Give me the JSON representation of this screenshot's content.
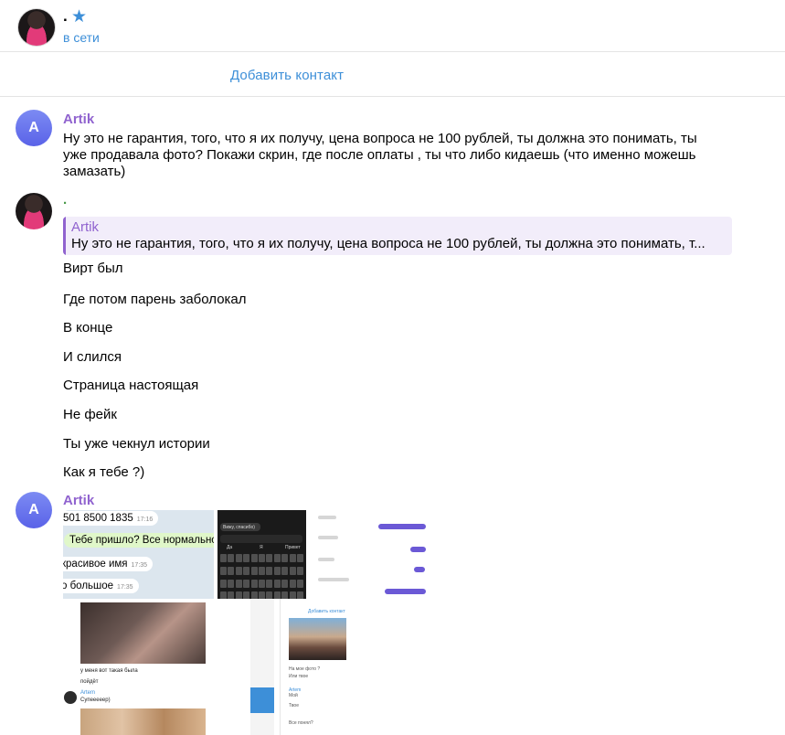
{
  "header": {
    "contact_name": ".",
    "status": "в сети",
    "star_icon": "star-icon"
  },
  "add_contact": {
    "label": "Добавить контакт"
  },
  "messages": [
    {
      "sender": "Artik",
      "avatar_letter": "A",
      "text_lines": [
        "Ну это не гарантия, того, что я их получу, цена вопроса не 100 рублей, ты должна это понимать, ты",
        "уже продавала фото? Покажи скрин, где после оплаты , ты что либо кидаешь (что именно можешь",
        "замазать)"
      ]
    },
    {
      "sender": ".",
      "reply": {
        "name": "Artik",
        "text": "Ну это не гарантия, того, что я их получу, цена вопроса не 100 рублей, ты должна это понимать, т..."
      },
      "lines": [
        "Вирт был",
        "Где потом парень заболокал",
        "В конце",
        "И слился",
        "Страница настоящая",
        "Не фейк",
        "Ты уже чекнул истории",
        "Как я тебе ?)"
      ]
    },
    {
      "sender": "Artik",
      "avatar_letter": "A",
      "screenshot1": {
        "row1": "501 8500 1835",
        "row1_time": "17:16",
        "row2": "Тебе пришло? Все нормально?",
        "row3": "красивое имя",
        "row3_time": "17:35",
        "row4": "о большое",
        "row4_time": "17:35"
      },
      "screenshot2": {
        "input_text": "Вижу, спасибо)",
        "suggestions": [
          "Да",
          "Я",
          "Привет"
        ]
      },
      "screenshot4": {
        "caption1": "у меня вот такая была",
        "caption2": "пойдёт",
        "name": "Artem",
        "caption3": "Супееееер)"
      },
      "screenshot5": {
        "add_contact": "Добавить контакт",
        "msg1": "На мое фото ?",
        "msg2": "Или твое",
        "name1": "Artem",
        "msg3": "Мой",
        "msg4": "Твое",
        "msg5": "Все понял?"
      }
    }
  ]
}
